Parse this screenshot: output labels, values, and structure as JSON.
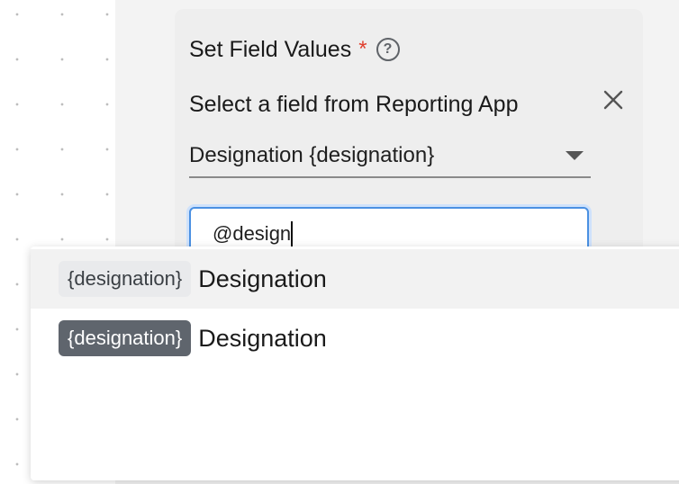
{
  "form": {
    "section_title": "Set Field Values",
    "required_mark": "*",
    "help_glyph": "?",
    "field_label": "Select a field from Reporting App",
    "close_icon": "close-icon",
    "select": {
      "value": "Designation {designation}"
    },
    "input": {
      "value": "@design"
    }
  },
  "suggestions": [
    {
      "token": "{designation}",
      "label": "Designation",
      "highlighted": true
    },
    {
      "token": "{designation}",
      "label": "Designation",
      "highlighted": false
    }
  ],
  "colors": {
    "required": "#e0402f",
    "focus_border": "#4a90e2",
    "token_light": "#e9eaec",
    "token_dark": "#5f656d"
  }
}
